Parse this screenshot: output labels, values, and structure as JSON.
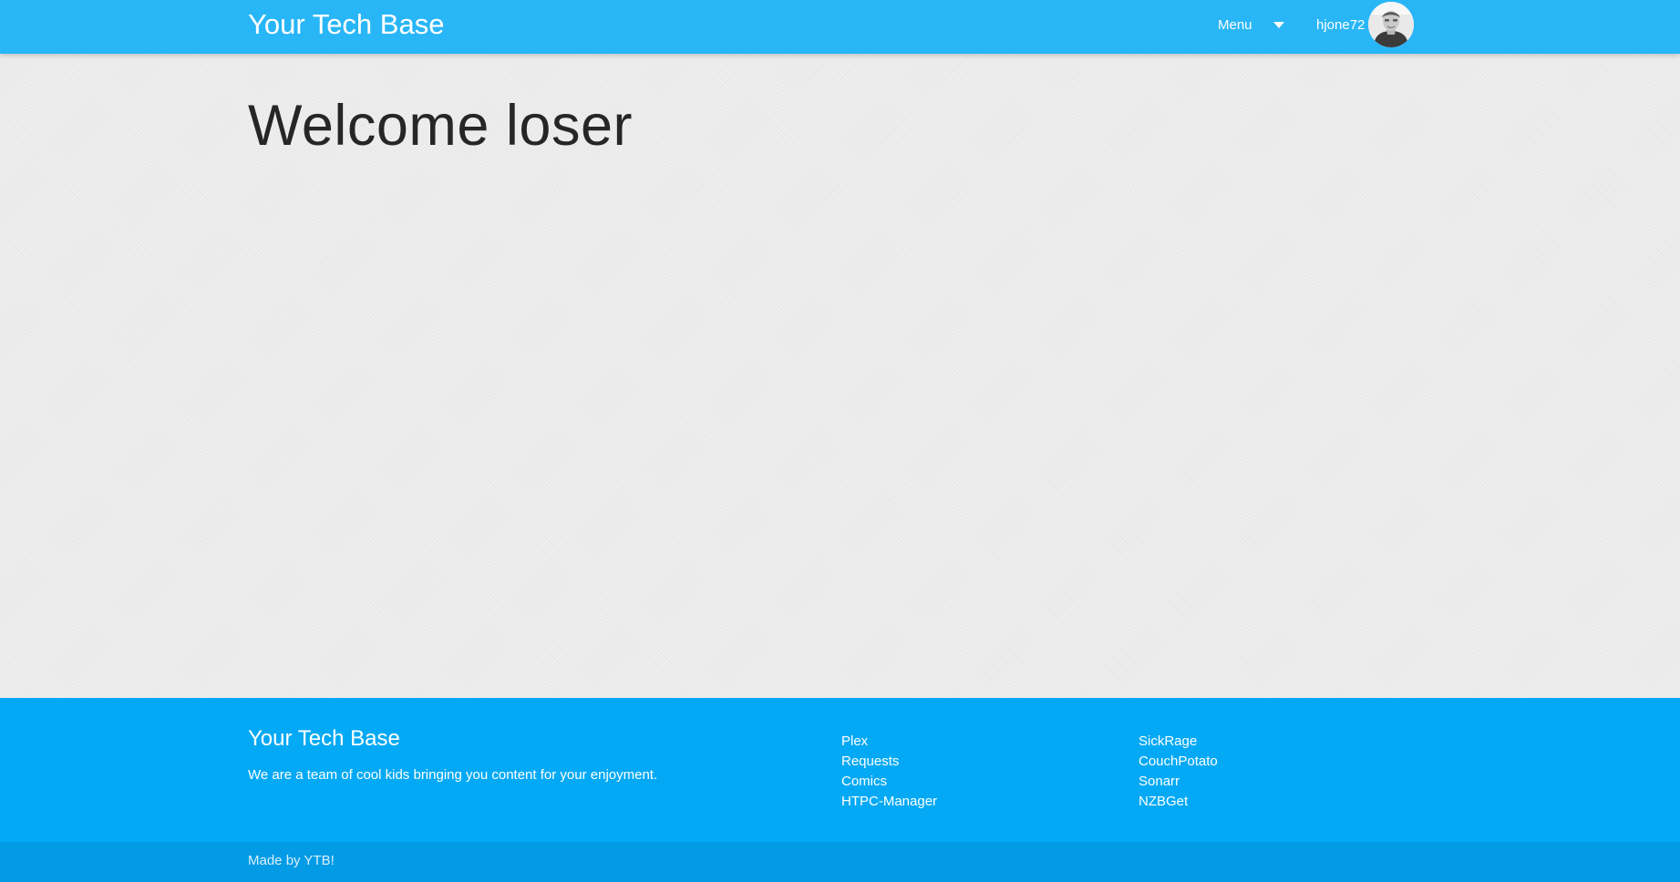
{
  "navbar": {
    "brand": "Your Tech Base",
    "menu_label": "Menu",
    "username": "hjone72"
  },
  "main": {
    "title": "Welcome loser"
  },
  "footer": {
    "title": "Your Tech Base",
    "description": "We are a team of cool kids bringing you content for your enjoyment.",
    "links_col1": [
      "Plex",
      "Requests",
      "Comics",
      "HTPC-Manager"
    ],
    "links_col2": [
      "SickRage",
      "CouchPotato",
      "Sonarr",
      "NZBGet"
    ],
    "made_by": "Made by YTB!"
  },
  "colors": {
    "navbar": "#29b6f6",
    "footer": "#03a9f4",
    "footer_bottom": "#039be5",
    "background": "#ebebeb"
  },
  "icons": {
    "menu_caret": "caret-down-icon",
    "avatar": "user-avatar"
  }
}
